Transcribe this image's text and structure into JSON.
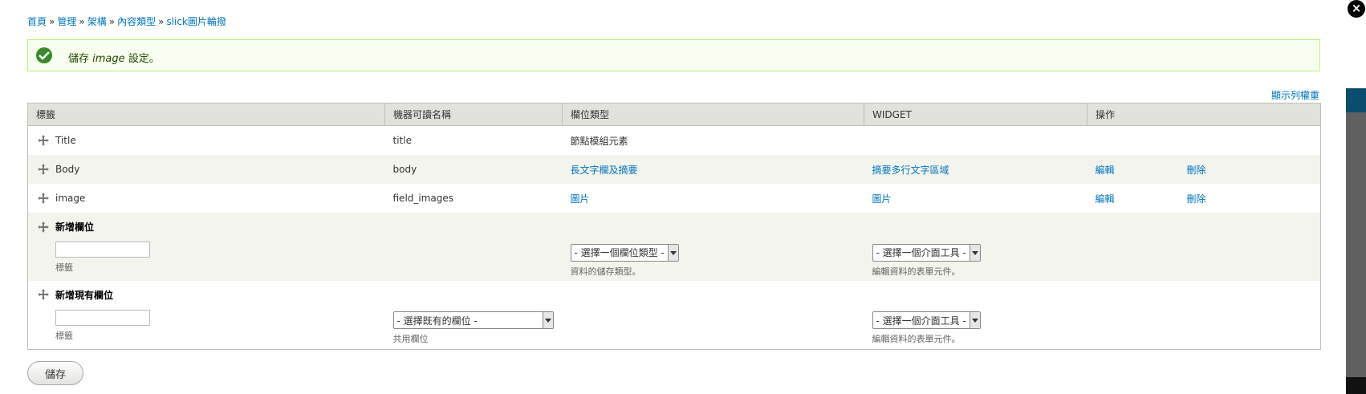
{
  "breadcrumb": [
    {
      "label": "首頁"
    },
    {
      "label": "管理"
    },
    {
      "label": "架構"
    },
    {
      "label": "內容類型"
    },
    {
      "label": "slick圖片輪撥"
    }
  ],
  "breadcrumb_sep": "»",
  "message": {
    "prefix": "儲存",
    "field": "image",
    "suffix": "設定。"
  },
  "weights_toggle": "顯示列權重",
  "table": {
    "headers": [
      "標籤",
      "機器可讀名稱",
      "欄位類型",
      "WIDGET",
      "操作"
    ],
    "rows": [
      {
        "label": "Title",
        "machine": "title",
        "type": "節點模組元素",
        "widget": "",
        "edit": "",
        "delete": ""
      },
      {
        "label": "Body",
        "machine": "body",
        "type": "長文字欄及摘要",
        "widget": "摘要多行文字區域",
        "edit": "編輯",
        "delete": "刪除"
      },
      {
        "label": "image",
        "machine": "field_images",
        "type": "圖片",
        "widget": "圖片",
        "edit": "編輯",
        "delete": "刪除"
      }
    ],
    "new_field": {
      "title": "新增欄位",
      "label_desc": "標籤",
      "type_select": "- 選擇一個欄位類型 -",
      "type_desc": "資料的儲存類型。",
      "widget_select": "- 選擇一個介面工具 -",
      "widget_desc": "編輯資料的表單元件。"
    },
    "existing_field": {
      "title": "新增現有欄位",
      "label_desc": "標籤",
      "field_select": "- 選擇既有的欄位 -",
      "field_desc": "共用欄位",
      "widget_select": "- 選擇一個介面工具 -",
      "widget_desc": "編輯資料的表單元件。"
    }
  },
  "save_label": "儲存",
  "close_label": "×",
  "colors": {
    "link": "#0074bd",
    "header_bg": "#e1e2dc",
    "message_bg": "#f8fff0",
    "success_icon": "#3a8a2a"
  }
}
